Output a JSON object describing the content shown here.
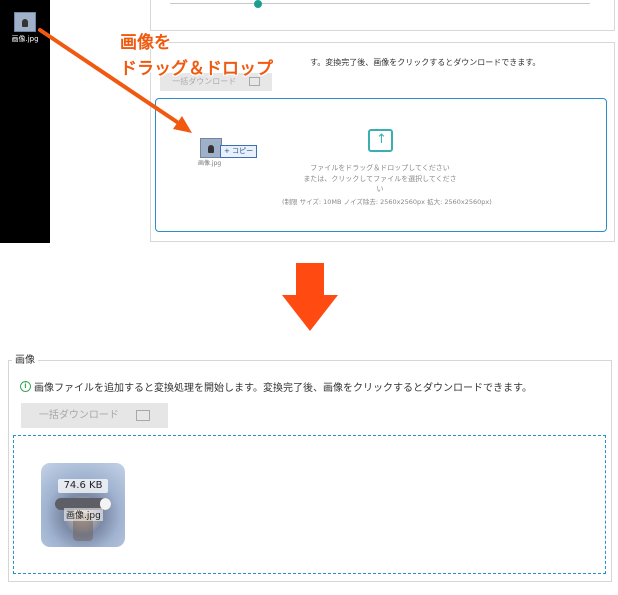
{
  "top": {
    "desktop_icon_label": "画像.jpg",
    "instruction_line1": "画像を",
    "instruction_line2": "ドラッグ＆ドロップ",
    "info_text": "す。変換完了後、画像をクリックするとダウンロードできます。",
    "bulk_download_label": "一括ダウンロード",
    "drop_text_line1": "ファイルをドラッグ＆ドロップしてください",
    "drop_text_line2": "または、クリックしてファイルを選択してください",
    "limits_text": "(制限 サイズ: 10MB ノイズ除去: 2560x2560px 拡大: 2560x2560px)",
    "drag_file_name": "画像.jpg",
    "copy_badge": "+ コピー",
    "arrow_color": "#f05a10"
  },
  "section": {
    "legend": "画像",
    "info_text": "画像ファイルを追加すると変換処理を開始します。変換完了後、画像をクリックするとダウンロードできます。",
    "bulk_download_label": "一括ダウンロード",
    "accent_color": "#2a8fc7"
  },
  "file_item": {
    "size": "74.6 KB",
    "name": "画像.jpg",
    "progress": 0.2
  },
  "icons": {
    "info": "info-circle-icon",
    "download": "download-icon",
    "upload": "upload-icon"
  }
}
